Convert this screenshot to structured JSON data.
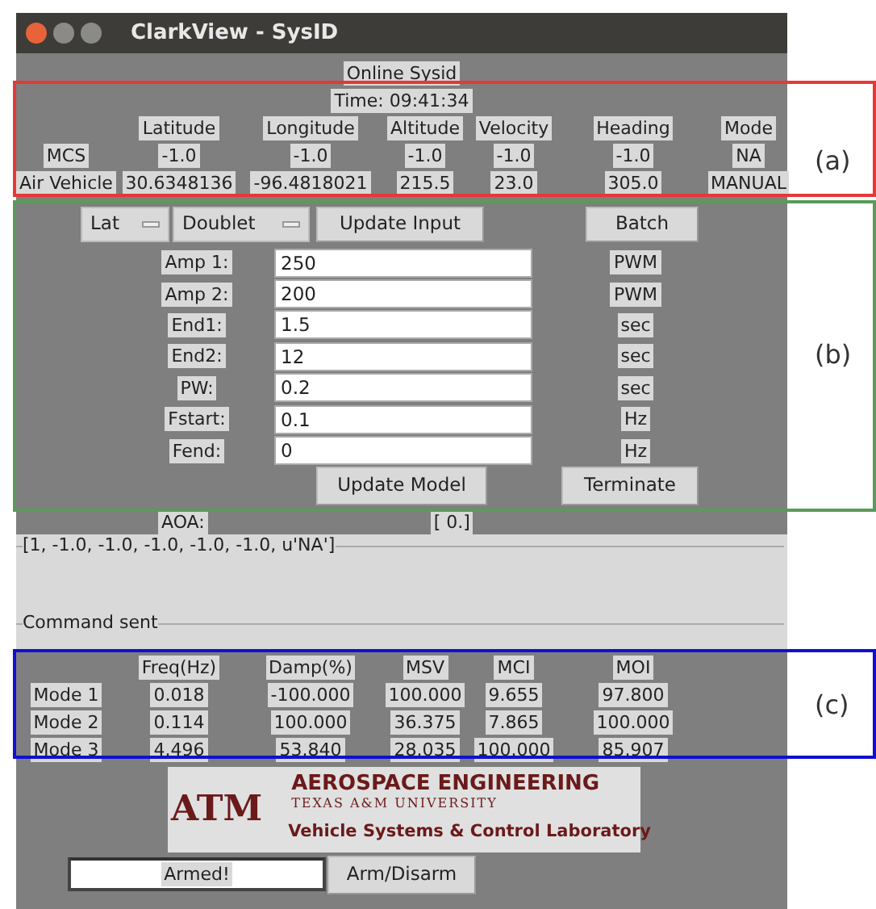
{
  "window": {
    "title": "ClarkView - SysID"
  },
  "header": {
    "title": "Online Sysid",
    "time": "Time: 09:41:34"
  },
  "telemetry": {
    "columns": [
      "Latitude",
      "Longitude",
      "Altitude",
      "Velocity",
      "Heading",
      "Mode"
    ],
    "rows": [
      {
        "label": "MCS",
        "cells": [
          "-1.0",
          "-1.0",
          "-1.0",
          "-1.0",
          "-1.0",
          "NA"
        ]
      },
      {
        "label": "Air Vehicle",
        "cells": [
          "30.6348136",
          "-96.4818021",
          "215.5",
          "23.0",
          "305.0",
          "MANUAL"
        ]
      }
    ]
  },
  "input": {
    "selectors": [
      {
        "value": "Lat"
      },
      {
        "value": "Doublet"
      }
    ],
    "update_input": "Update Input",
    "batch": "Batch",
    "fields": [
      {
        "label": "Amp 1:",
        "value": "250",
        "unit": "PWM"
      },
      {
        "label": "Amp 2:",
        "value": "200",
        "unit": "PWM"
      },
      {
        "label": "End1:",
        "value": "1.5",
        "unit": "sec"
      },
      {
        "label": "End2:",
        "value": "12",
        "unit": "sec"
      },
      {
        "label": "PW:",
        "value": "0.2",
        "unit": "sec"
      },
      {
        "label": "Fstart:",
        "value": "0.1",
        "unit": "Hz"
      },
      {
        "label": "Fend:",
        "value": "0",
        "unit": "Hz"
      }
    ],
    "update_model": "Update Model",
    "terminate": "Terminate"
  },
  "aoa": {
    "label": "AOA:",
    "value": "[ 0.]"
  },
  "frames": [
    {
      "title": "[1, -1.0, -1.0, -1.0, -1.0, -1.0, u'NA']"
    },
    {
      "title": "Command sent"
    }
  ],
  "modes": {
    "columns": [
      "Freq(Hz)",
      "Damp(%)",
      "MSV",
      "MCI",
      "MOI"
    ],
    "rows": [
      {
        "label": "Mode 1",
        "cells": [
          "0.018",
          "-100.000",
          "100.000",
          "9.655",
          "97.800"
        ]
      },
      {
        "label": "Mode 2",
        "cells": [
          "0.114",
          "100.000",
          "36.375",
          "7.865",
          "100.000"
        ]
      },
      {
        "label": "Mode 3",
        "cells": [
          "4.496",
          "53.840",
          "28.035",
          "100.000",
          "85.907"
        ]
      }
    ]
  },
  "logo": {
    "mark": "ATM",
    "title": "AEROSPACE ENGINEERING",
    "subtitle": "TEXAS A&M UNIVERSITY",
    "lab": "Vehicle Systems & Control Laboratory"
  },
  "arm": {
    "status": "Armed!",
    "button": "Arm/Disarm"
  },
  "annotations": [
    {
      "label": "(a)",
      "color": "#e53935"
    },
    {
      "label": "(b)",
      "color": "#5a9a5a"
    },
    {
      "label": "(c)",
      "color": "#1010d0"
    }
  ]
}
